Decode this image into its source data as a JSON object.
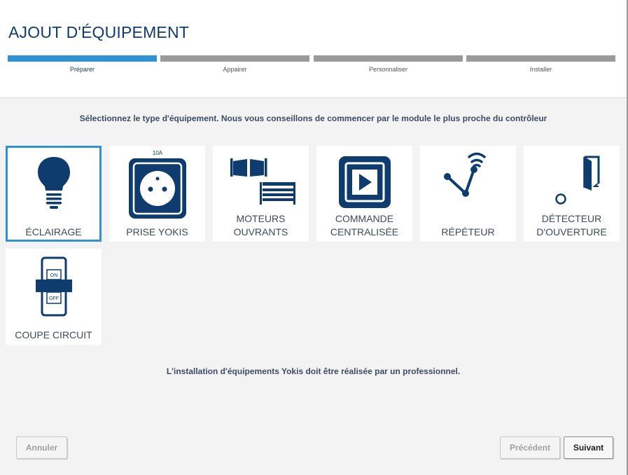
{
  "header": {
    "title": "AJOUT D'ÉQUIPEMENT"
  },
  "steps": [
    {
      "label": "Préparer",
      "active": true
    },
    {
      "label": "Appairer",
      "active": false
    },
    {
      "label": "Personnaliser",
      "active": false
    },
    {
      "label": "Installer",
      "active": false
    }
  ],
  "instruction": "Sélectionnez le type d'équipement. Nous vous conseillons de commencer par le module le plus proche du contrôleur",
  "tiles": [
    {
      "label": "ÉCLAIRAGE",
      "icon": "light-bulb-icon",
      "selected": true
    },
    {
      "label": "PRISE YOKIS",
      "icon": "power-socket-icon",
      "badge": "10A"
    },
    {
      "label": "MOTEURS OUVRANTS",
      "icon": "gate-motors-icon"
    },
    {
      "label": "COMMANDE CENTRALISÉE",
      "icon": "play-control-icon"
    },
    {
      "label": "RÉPÉTEUR",
      "icon": "repeater-icon"
    },
    {
      "label": "DÉTECTEUR D'OUVERTURE",
      "icon": "door-sensor-icon"
    },
    {
      "label": "COUPE CIRCUIT",
      "icon": "circuit-breaker-icon",
      "on_text": "ON",
      "off_text": "OFF"
    }
  ],
  "footer_note": "L'installation d'équipements Yokis doit être réalisée par un professionnel.",
  "buttons": {
    "cancel": "Annuler",
    "previous": "Précédent",
    "next": "Suivant"
  },
  "colors": {
    "accent": "#3092d3",
    "icon": "#0f3c6e",
    "step_inactive": "#9a9a9a"
  }
}
